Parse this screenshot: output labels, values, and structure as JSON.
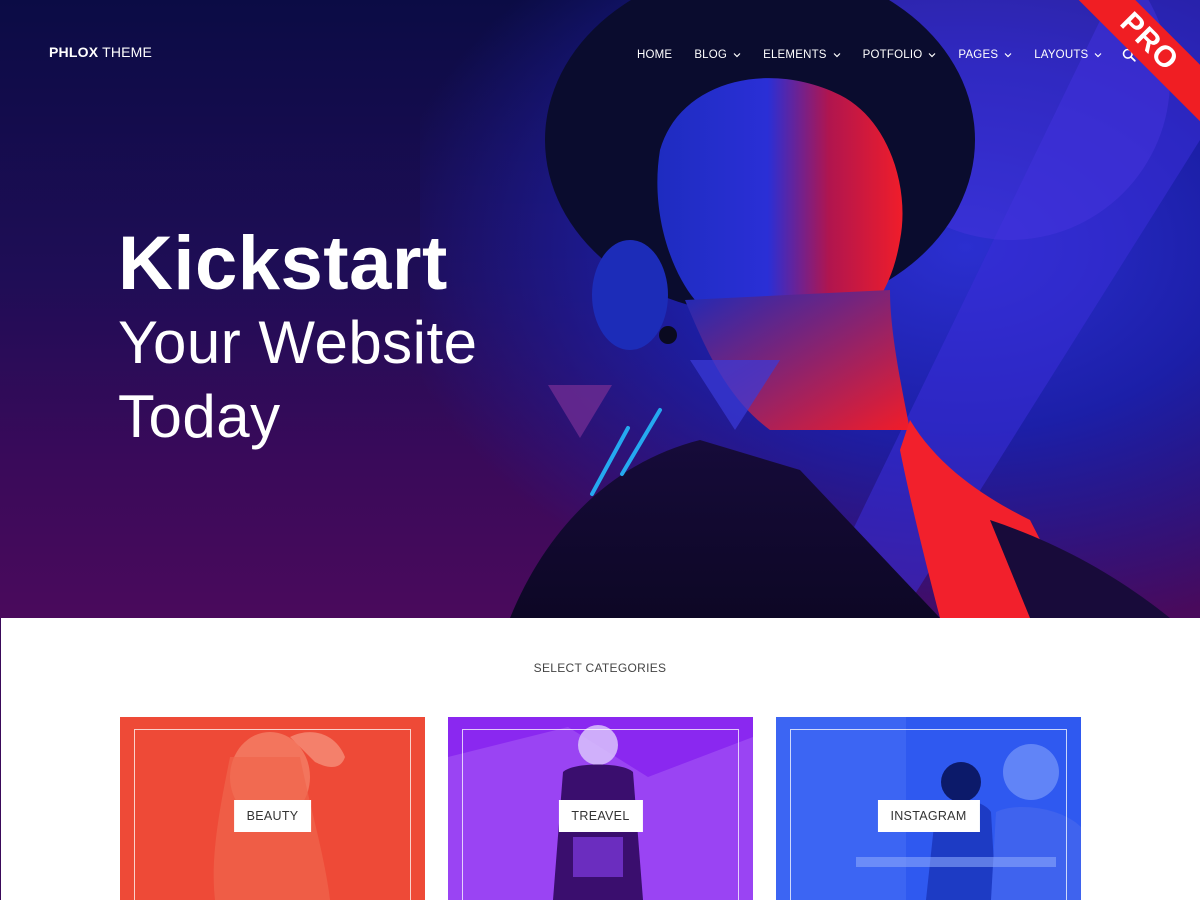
{
  "brand": {
    "bold": "PHLOX",
    "light": "THEME"
  },
  "nav": {
    "items": [
      {
        "label": "HOME",
        "has_dropdown": false
      },
      {
        "label": "BLOG",
        "has_dropdown": true
      },
      {
        "label": "ELEMENTS",
        "has_dropdown": true
      },
      {
        "label": "POTFOLIO",
        "has_dropdown": true
      },
      {
        "label": "PAGES",
        "has_dropdown": true
      },
      {
        "label": "LAYOUTS",
        "has_dropdown": true
      }
    ],
    "search_icon": "search-icon"
  },
  "ribbon": {
    "label": "PRO",
    "color": "#f01e23"
  },
  "hero": {
    "line1": "Kickstart",
    "line2": "Your Website",
    "line3": "Today"
  },
  "categories": {
    "title": "SELECT CATEGORIES",
    "cards": [
      {
        "label": "BEAUTY",
        "color": "#ee4a37"
      },
      {
        "label": "TREAVEL",
        "color": "#8a28f0"
      },
      {
        "label": "INSTAGRAM",
        "color": "#2f59f0"
      }
    ]
  },
  "colors": {
    "hero_dark": "#0b0c45",
    "hero_purple": "#3a0a5a",
    "accent_blue": "#2b2fd0",
    "accent_red": "#f5202a",
    "accent_cyan": "#25a9f0"
  }
}
